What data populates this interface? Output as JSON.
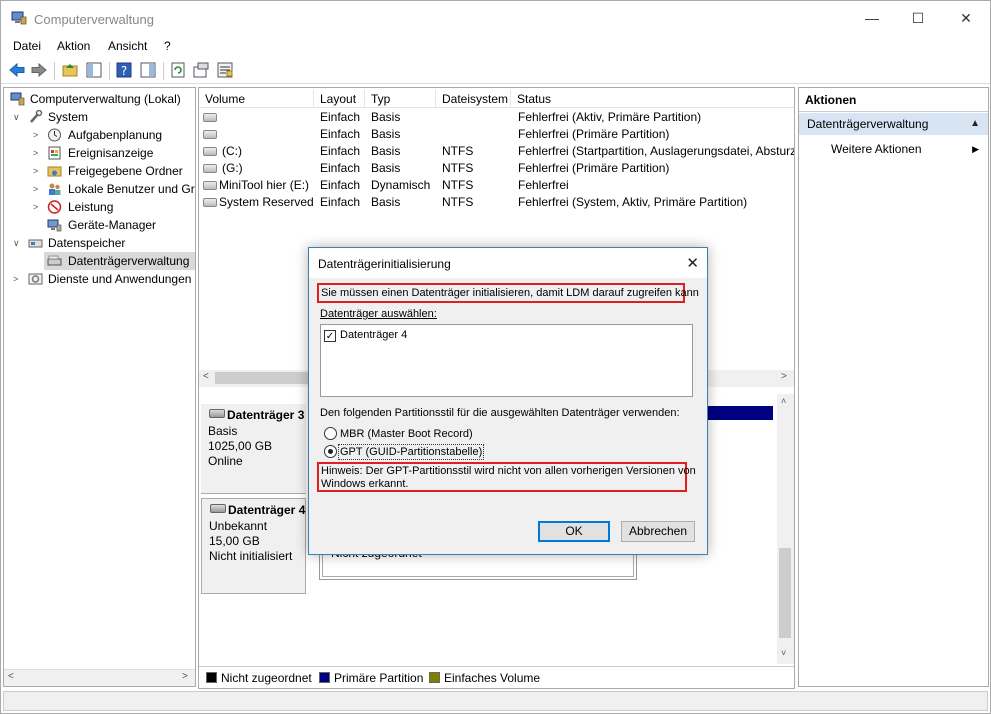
{
  "window": {
    "title": "Computerverwaltung"
  },
  "menu": [
    "Datei",
    "Aktion",
    "Ansicht",
    "?"
  ],
  "tree": [
    {
      "label": "Computerverwaltung (Lokal)",
      "icon": "computer-icon",
      "level": 0,
      "expand": ""
    },
    {
      "label": "System",
      "icon": "tools-icon",
      "level": 1,
      "expand": "open"
    },
    {
      "label": "Aufgabenplanung",
      "icon": "clock-icon",
      "level": 2,
      "expand": "closed"
    },
    {
      "label": "Ereignisanzeige",
      "icon": "event-log-icon",
      "level": 2,
      "expand": "closed"
    },
    {
      "label": "Freigegebene Ordner",
      "icon": "shared-folder-icon",
      "level": 2,
      "expand": "closed"
    },
    {
      "label": "Lokale Benutzer und Gr",
      "icon": "users-icon",
      "level": 2,
      "expand": "closed"
    },
    {
      "label": "Leistung",
      "icon": "performance-icon",
      "level": 2,
      "expand": "closed"
    },
    {
      "label": "Geräte-Manager",
      "icon": "device-manager-icon",
      "level": 2,
      "expand": ""
    },
    {
      "label": "Datenspeicher",
      "icon": "storage-icon",
      "level": 1,
      "expand": "open"
    },
    {
      "label": "Datenträgerverwaltung",
      "icon": "disk-management-icon",
      "level": 2,
      "expand": "",
      "selected": true
    },
    {
      "label": "Dienste und Anwendungen",
      "icon": "services-icon",
      "level": 1,
      "expand": "closed"
    }
  ],
  "columns": [
    "Volume",
    "Layout",
    "Typ",
    "Dateisystem",
    "Status"
  ],
  "volumes": [
    {
      "volume": "",
      "layout": "Einfach",
      "typ": "Basis",
      "fs": "",
      "status": "Fehlerfrei (Aktiv, Primäre Partition)"
    },
    {
      "volume": "",
      "layout": "Einfach",
      "typ": "Basis",
      "fs": "",
      "status": "Fehlerfrei (Primäre Partition)"
    },
    {
      "volume": "(C:)",
      "layout": "Einfach",
      "typ": "Basis",
      "fs": "NTFS",
      "status": "Fehlerfrei (Startpartition, Auslagerungsdatei, Absturz"
    },
    {
      "volume": "(G:)",
      "layout": "Einfach",
      "typ": "Basis",
      "fs": "NTFS",
      "status": "Fehlerfrei (Primäre Partition)"
    },
    {
      "volume": "MiniTool hier (E:)",
      "layout": "Einfach",
      "typ": "Dynamisch",
      "fs": "NTFS",
      "status": "Fehlerfrei"
    },
    {
      "volume": "System Reserved",
      "layout": "Einfach",
      "typ": "Basis",
      "fs": "NTFS",
      "status": "Fehlerfrei (System, Aktiv, Primäre Partition)"
    }
  ],
  "disks": [
    {
      "name": "Datenträger 3",
      "type": "Basis",
      "size": "1025,00 GB",
      "state": "Online"
    },
    {
      "name": "Datenträger 4",
      "type": "Unbekannt",
      "size": "15,00 GB",
      "state": "Nicht initialisiert",
      "partition": "Nicht zugeordnet"
    }
  ],
  "legend": [
    {
      "label": "Nicht zugeordnet",
      "color": "#000000"
    },
    {
      "label": "Primäre Partition",
      "color": "#000080"
    },
    {
      "label": "Einfaches Volume",
      "color": "#808000"
    }
  ],
  "actions": {
    "header": "Aktionen",
    "section": "Datenträgerverwaltung",
    "item": "Weitere Aktionen"
  },
  "dialog": {
    "title": "Datenträgerinitialisierung",
    "message": "Sie müssen einen Datenträger initialisieren, damit LDM darauf zugreifen kann",
    "select_label": "Datenträger auswählen:",
    "disk_item": "Datenträger 4",
    "style_label": "Den folgenden Partitionsstil für die ausgewählten Datenträger verwenden:",
    "mbr": "MBR (Master Boot Record)",
    "gpt": "GPT (GUID-Partitionstabelle)",
    "hint_line1": "Hinweis: Der GPT-Partitionsstil wird nicht von allen vorherigen Versionen von",
    "hint_line2": "Windows erkannt.",
    "ok": "OK",
    "cancel": "Abbrechen"
  }
}
